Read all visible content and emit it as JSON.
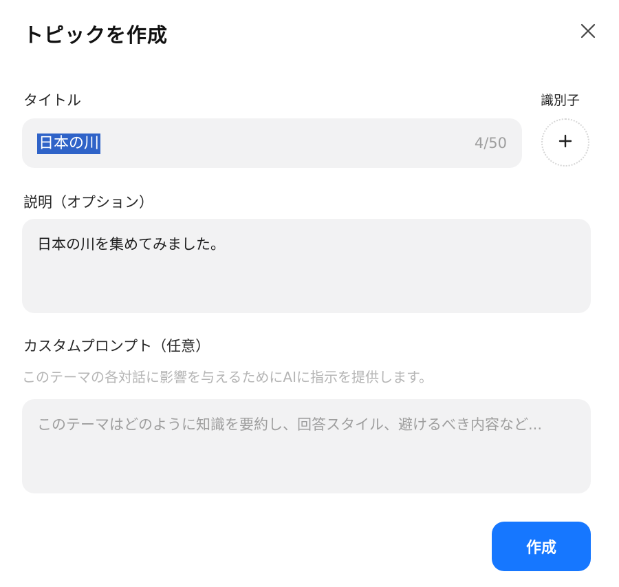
{
  "dialog": {
    "title": "トピックを作成",
    "close_icon": "close-icon"
  },
  "title_field": {
    "label": "タイトル",
    "value": "日本の川",
    "char_count": "4/50"
  },
  "identifier": {
    "label": "識別子",
    "add_icon": "plus-icon"
  },
  "description_field": {
    "label": "説明（オプション）",
    "value": "日本の川を集めてみました。"
  },
  "custom_prompt_field": {
    "label": "カスタムプロンプト（任意）",
    "hint": "このテーマの各対話に影響を与えるためにAIに指示を提供します。",
    "placeholder": "このテーマはどのように知識を要約し、回答スタイル、避けるべき内容など..."
  },
  "actions": {
    "create_label": "作成"
  },
  "colors": {
    "accent": "#1677ff",
    "selection": "#2f63c8",
    "field_background": "#f2f2f3"
  }
}
